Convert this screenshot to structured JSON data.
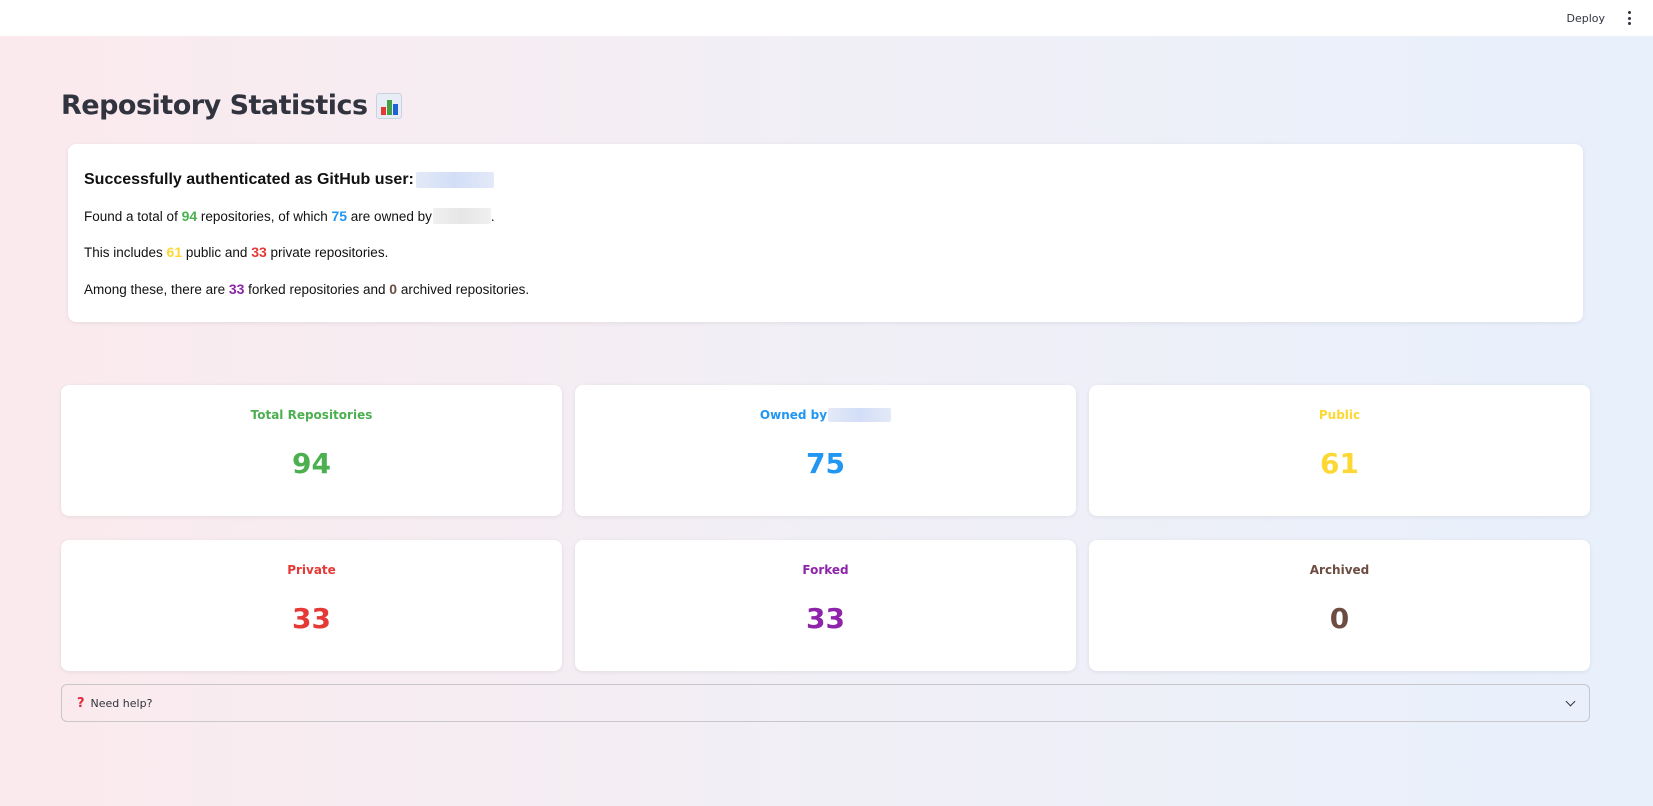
{
  "topbar": {
    "deploy_label": "Deploy"
  },
  "page": {
    "title": "Repository Statistics"
  },
  "auth": {
    "heading": "Successfully authenticated as GitHub user:",
    "line1": {
      "a": "Found a total of ",
      "total": "94",
      "b": " repositories, of which ",
      "owned": "75",
      "c": " are owned by",
      "d": "."
    },
    "line2": {
      "a": "This includes ",
      "public": "61",
      "b": " public and ",
      "private": "33",
      "c": " private repositories."
    },
    "line3": {
      "a": "Among these, there are ",
      "forked": "33",
      "b": " forked repositories and ",
      "archived": "0",
      "c": " archived repositories."
    }
  },
  "stats": [
    {
      "label": "Total Repositories",
      "value": "94",
      "color": "#4caf50"
    },
    {
      "label": "Owned by",
      "value": "75",
      "color": "#2196f3"
    },
    {
      "label": "Public",
      "value": "61",
      "color": "#fdd835"
    },
    {
      "label": "Private",
      "value": "33",
      "color": "#e53935"
    },
    {
      "label": "Forked",
      "value": "33",
      "color": "#8e24aa"
    },
    {
      "label": "Archived",
      "value": "0",
      "color": "#6d4c41"
    }
  ],
  "help": {
    "label": "Need help?",
    "icon": "question-mark-icon"
  }
}
